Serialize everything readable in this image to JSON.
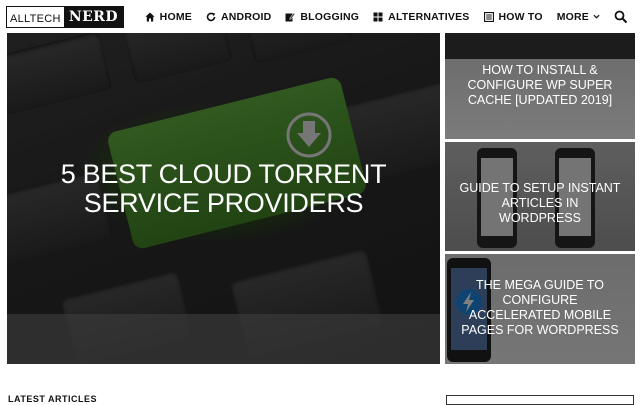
{
  "header": {
    "logo": {
      "left": "ALLTECH",
      "right": "NERD"
    },
    "nav": [
      {
        "label": "HOME",
        "icon": "home-icon"
      },
      {
        "label": "ANDROID",
        "icon": "refresh-icon"
      },
      {
        "label": "BLOGGING",
        "icon": "edit-icon"
      },
      {
        "label": "ALTERNATIVES",
        "icon": "grid-icon"
      },
      {
        "label": "HOW TO",
        "icon": "list-icon"
      },
      {
        "label": "MORE",
        "icon": "chevron-down-icon"
      }
    ],
    "search_icon": "search-icon"
  },
  "hero": {
    "title": "5 BEST CLOUD TORRENT SERVICE PROVIDERS"
  },
  "side_posts": [
    {
      "title": "HOW TO INSTALL & CONFIGURE WP SUPER CACHE [UPDATED 2019]"
    },
    {
      "title": "GUIDE TO SETUP INSTANT ARTICLES IN WORDPRESS"
    },
    {
      "title": "THE MEGA GUIDE TO CONFIGURE ACCELERATED MOBILE PAGES FOR WORDPRESS"
    }
  ],
  "section": {
    "latest_label": "LATEST ARTICLES"
  },
  "colors": {
    "accent_green": "#4a9130",
    "dark": "#111111"
  }
}
